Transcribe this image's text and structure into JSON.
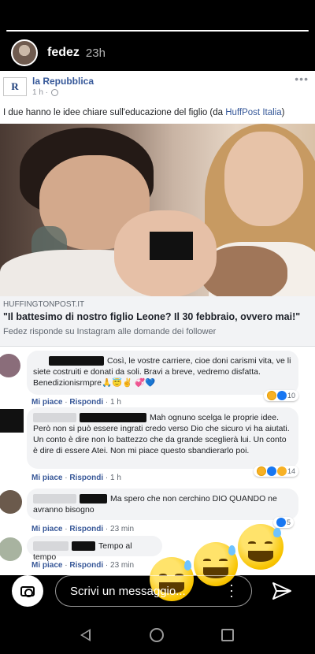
{
  "story": {
    "username": "fedez",
    "time": "23h"
  },
  "post": {
    "page_name": "la Repubblica",
    "page_logo_text": "R",
    "time": "1 h ·",
    "text_before_link": "I due hanno le idee chiare sull'educazione del figlio (da ",
    "text_link": "HuffPost Italia",
    "text_after_link": ")",
    "link": {
      "domain": "HUFFINGTONPOST.IT",
      "title": "\"Il battesimo di nostro figlio Leone? Il 30 febbraio, ovvero mai!\"",
      "description": "Fedez risponde su Instagram alle domande dei follower"
    }
  },
  "comments": [
    {
      "text": "Così, le vostre carriere, cioe doni carismi vita, ve li siete costruiti e donati da soli. Bravi a breve, vedremo disfatta. Benedizionisrmpre🙏😇✌️     💞💙",
      "like": "Mi piace",
      "reply": "Rispondi",
      "time": "1 h",
      "reaction_count": "10"
    },
    {
      "text": "Mah ognuno scelga le proprie idee. Però non si può essere ingrati credo verso Dio che sicuro vi ha aiutati. Un conto è dire non lo battezzo che da grande sceglierà lui. Un conto è dire di essere Atei. Non mi piace questo sbandierarlo poi.",
      "like": "Mi piace",
      "reply": "Rispondi",
      "time": "1 h",
      "reaction_count": "14"
    },
    {
      "text": "Ma spero che non cerchino DIO QUANDO ne avranno bisogno",
      "like": "Mi piace",
      "reply": "Rispondi",
      "time": "23 min",
      "reaction_count": "5"
    },
    {
      "text": "Tempo al tempo",
      "like": "Mi piace",
      "reply": "Rispondi",
      "time": "23 min"
    }
  ],
  "reply_bar": {
    "placeholder": "Scrivi un messaggio..."
  },
  "icons": {
    "camera": "camera-icon",
    "more": "more-vertical-icon",
    "send": "send-icon",
    "emoji": "grinning-sweat-emoji"
  },
  "colors": {
    "facebook_link": "#365899",
    "facebook_action": "#385898",
    "background": "#000000"
  }
}
